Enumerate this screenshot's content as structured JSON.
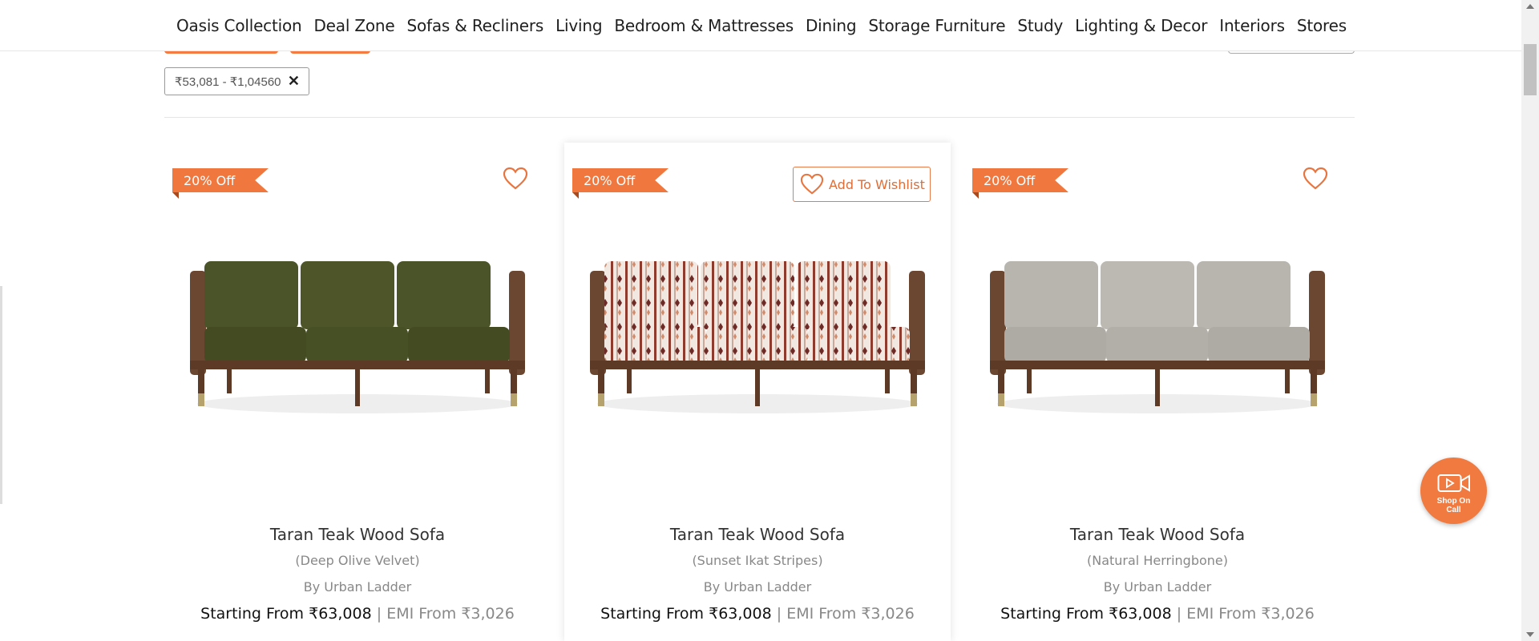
{
  "nav": {
    "items": [
      {
        "label": "Oasis Collection"
      },
      {
        "label": "Deal Zone"
      },
      {
        "label": "Sofas & Recliners"
      },
      {
        "label": "Living"
      },
      {
        "label": "Bedroom & Mattresses"
      },
      {
        "label": "Dining"
      },
      {
        "label": "Storage Furniture"
      },
      {
        "label": "Study"
      },
      {
        "label": "Lighting & Decor"
      },
      {
        "label": "Interiors"
      },
      {
        "label": "Stores"
      }
    ]
  },
  "filter_chip": {
    "label": "₹53,081 - ₹1,04560",
    "close": "✕"
  },
  "colors": {
    "accent": "#f0783e",
    "text": "#333333",
    "muted": "#888888"
  },
  "products": [
    {
      "discount": "20% Off",
      "wishlist_icon": "heart-icon",
      "title": "Taran Teak Wood Sofa",
      "variant": "(Deep Olive Velvet)",
      "brand": "By Urban Ladder",
      "price_label": "Starting From ₹63,008",
      "separator": "|",
      "emi_label": "EMI From ₹3,026",
      "fabric": "olive"
    },
    {
      "discount": "20% Off",
      "wishlist_label": "Add To Wishlist",
      "title": "Taran Teak Wood Sofa",
      "variant": "(Sunset Ikat Stripes)",
      "brand": "By Urban Ladder",
      "price_label": "Starting From ₹63,008",
      "separator": "|",
      "emi_label": "EMI From ₹3,026",
      "fabric": "ikat"
    },
    {
      "discount": "20% Off",
      "wishlist_icon": "heart-icon",
      "title": "Taran Teak Wood Sofa",
      "variant": "(Natural Herringbone)",
      "brand": "By Urban Ladder",
      "price_label": "Starting From ₹63,008",
      "separator": "|",
      "emi_label": "EMI From ₹3,026",
      "fabric": "grey"
    }
  ],
  "shop_on_call": {
    "label_line1": "Shop On",
    "label_line2": "Call",
    "icon": "video-call-icon"
  }
}
